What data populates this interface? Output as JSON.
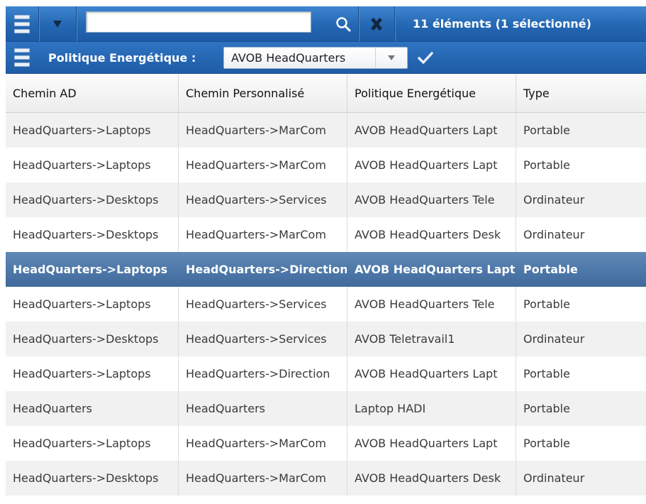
{
  "toolbar": {
    "search_value": "",
    "count_label": "11 éléments (1 sélectionné)",
    "icons": {
      "menu": "hamburger-menu-icon",
      "dropdown": "triangle-down-icon",
      "search": "magnifier-icon",
      "clear": "x-icon"
    }
  },
  "policy_bar": {
    "label": "Politique Energétique :",
    "selected": "AVOB HeadQuarters",
    "icons": {
      "menu": "hamburger-menu-icon",
      "dropdown": "triangle-down-icon",
      "confirm": "checkmark-icon"
    }
  },
  "table": {
    "columns": [
      "Chemin AD",
      "Chemin Personnalisé",
      "Politique Energétique",
      "Type"
    ],
    "selected_row": 4,
    "rows": [
      [
        "HeadQuarters->Laptops",
        "HeadQuarters->MarCom",
        "AVOB HeadQuarters Lapt",
        "Portable"
      ],
      [
        "HeadQuarters->Laptops",
        "HeadQuarters->MarCom",
        "AVOB HeadQuarters Lapt",
        "Portable"
      ],
      [
        "HeadQuarters->Desktops",
        "HeadQuarters->Services",
        "AVOB HeadQuarters Tele",
        "Ordinateur"
      ],
      [
        "HeadQuarters->Desktops",
        "HeadQuarters->MarCom",
        "AVOB HeadQuarters Desk",
        "Ordinateur"
      ],
      [
        "HeadQuarters->Laptops",
        "HeadQuarters->Direction",
        "AVOB HeadQuarters Lapt",
        "Portable"
      ],
      [
        "HeadQuarters->Laptops",
        "HeadQuarters->Services",
        "AVOB HeadQuarters Tele",
        "Portable"
      ],
      [
        "HeadQuarters->Desktops",
        "HeadQuarters->Services",
        "AVOB Teletravail1",
        "Ordinateur"
      ],
      [
        "HeadQuarters->Laptops",
        "HeadQuarters->Direction",
        "AVOB HeadQuarters Lapt",
        "Portable"
      ],
      [
        "HeadQuarters",
        "HeadQuarters",
        "Laptop HADI",
        "Portable"
      ],
      [
        "HeadQuarters->Laptops",
        "HeadQuarters->MarCom",
        "AVOB HeadQuarters Lapt",
        "Portable"
      ],
      [
        "HeadQuarters->Desktops",
        "HeadQuarters->MarCom",
        "AVOB HeadQuarters Desk",
        "Ordinateur"
      ]
    ]
  },
  "colors": {
    "toolbar_blue": "#2467b3",
    "selected_row": "#4a75a6",
    "alt_row": "#f1f1f1"
  }
}
